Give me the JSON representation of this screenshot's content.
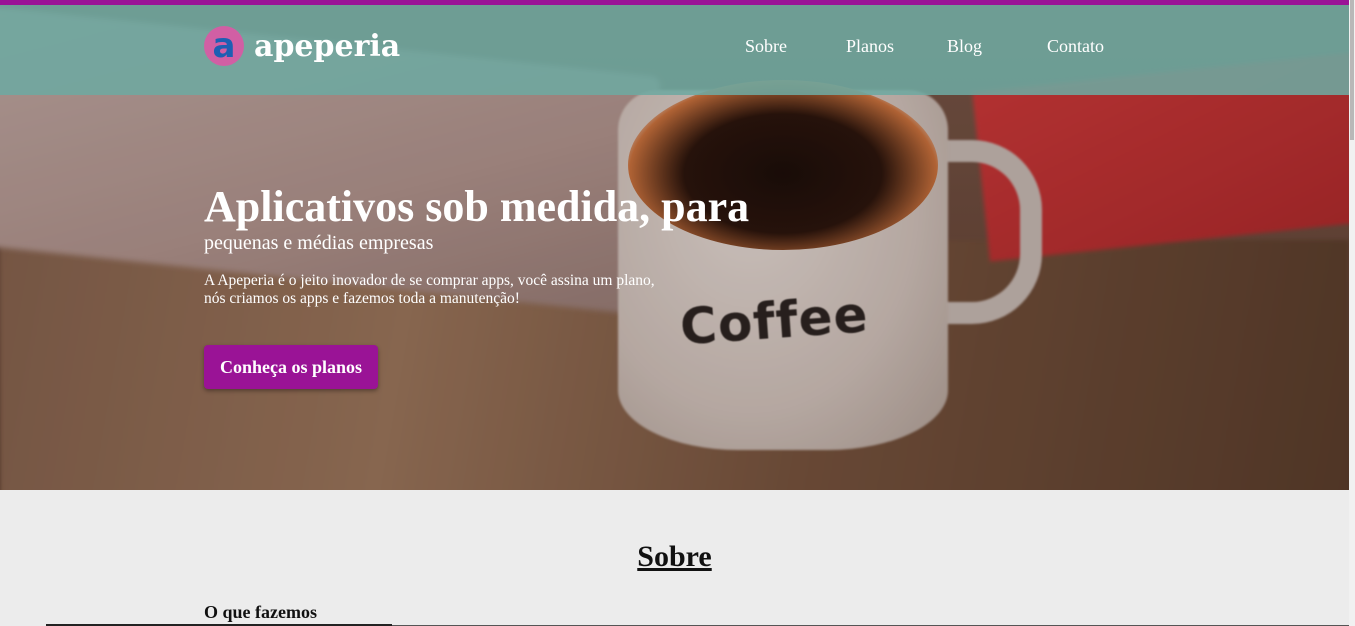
{
  "colors": {
    "accent": "#9a1396",
    "navbar": "#6ea8a0",
    "logo_circle": "#d15fa4",
    "logo_letter": "#1d5fb3",
    "section_bg": "#ececec"
  },
  "brand": {
    "logo_letter": "a",
    "name": "apeperia"
  },
  "nav": {
    "items": [
      {
        "label": "Sobre"
      },
      {
        "label": "Planos"
      },
      {
        "label": "Blog"
      },
      {
        "label": "Contato"
      }
    ]
  },
  "hero": {
    "title": "Aplicativos sob medida, para",
    "subtitle": "pequenas e médias empresas",
    "description_line1": "A Apeperia é o jeito inovador de se comprar apps, você assina um plano,",
    "description_line2": "nós criamos os apps e fazemos toda a manutenção!",
    "cta_label": "Conheça os planos",
    "image_text": "Coffee"
  },
  "about": {
    "title": "Sobre",
    "subtitle": "O que fazemos"
  }
}
